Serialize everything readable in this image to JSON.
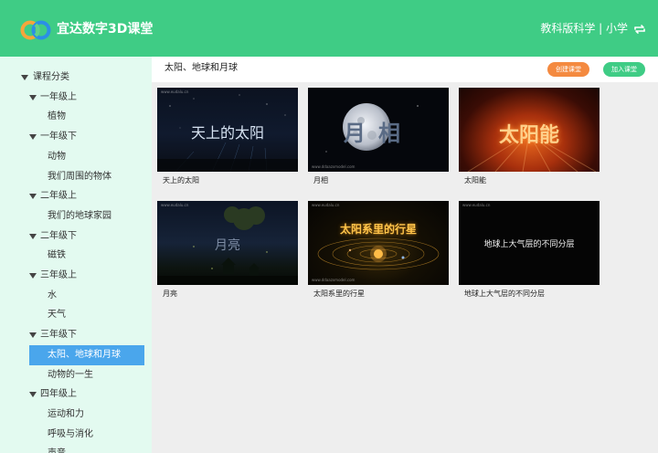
{
  "header": {
    "title": "宜达数字3D课堂",
    "edition": "教科版科学 | 小学"
  },
  "sidebar": {
    "items": [
      {
        "label": "课程分类",
        "level": 0,
        "expanded": true
      },
      {
        "label": "一年级上",
        "level": 1,
        "expanded": true
      },
      {
        "label": "植物",
        "level": 2
      },
      {
        "label": "一年级下",
        "level": 1,
        "expanded": true
      },
      {
        "label": "动物",
        "level": 2
      },
      {
        "label": "我们周围的物体",
        "level": 2
      },
      {
        "label": "二年级上",
        "level": 1,
        "expanded": true
      },
      {
        "label": "我们的地球家园",
        "level": 2
      },
      {
        "label": "二年级下",
        "level": 1,
        "expanded": true
      },
      {
        "label": "磁铁",
        "level": 2
      },
      {
        "label": "三年级上",
        "level": 1,
        "expanded": true
      },
      {
        "label": "水",
        "level": 2
      },
      {
        "label": "天气",
        "level": 2
      },
      {
        "label": "三年级下",
        "level": 1,
        "expanded": true
      },
      {
        "label": "太阳、地球和月球",
        "level": 2,
        "selected": true
      },
      {
        "label": "动物的一生",
        "level": 2
      },
      {
        "label": "四年级上",
        "level": 1,
        "expanded": true
      },
      {
        "label": "运动和力",
        "level": 2
      },
      {
        "label": "呼吸与消化",
        "level": 2
      },
      {
        "label": "声音",
        "level": 2
      }
    ]
  },
  "topbar": {
    "title": "太阳、地球和月球",
    "create_label": "创建课堂",
    "join_label": "加入课堂"
  },
  "colors": {
    "brand": "#3fcc85",
    "sidebar_bg": "#e3faf0",
    "selected": "#4aa6ec",
    "create_button": "#f48a40"
  },
  "courses": [
    {
      "thumb_text": "天上的太阳",
      "caption": "天上的太阳"
    },
    {
      "thumb_text": "月相",
      "caption": "月相"
    },
    {
      "thumb_text": "太阳能",
      "caption": "太阳能"
    },
    {
      "thumb_text": "月亮",
      "caption": "月亮"
    },
    {
      "thumb_text": "太阳系里的行星",
      "caption": "太阳系里的行星"
    },
    {
      "thumb_text": "地球上大气层的不同分层",
      "caption": "地球上大气层的不同分层"
    }
  ],
  "watermarks": {
    "site": "www.eudalu.cn",
    "site2": "www.ddaazxmodel.com"
  }
}
